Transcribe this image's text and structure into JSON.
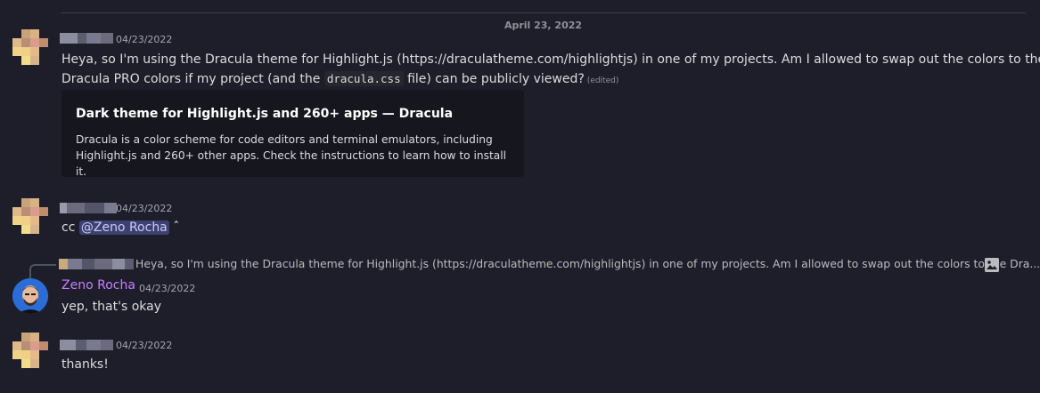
{
  "divider": {
    "date": "April 23, 2022"
  },
  "messages": [
    {
      "timestamp": "04/23/2022",
      "text_prefix": "Heya, so I'm using the Dracula theme for Highlight.js (",
      "link": "https://draculatheme.com/highlightjs",
      "text_mid": ") in one of my projects. Am I allowed to swap out the colors to the",
      "text_line2_prefix": "Dracula PRO colors if my project (and the ",
      "code": "dracula.css",
      "text_line2_suffix": " file) can be publicly viewed?",
      "edited": "(edited)",
      "embed": {
        "title": "Dark theme for Highlight.js and 260+ apps — Dracula",
        "description": "Dracula is a color scheme for code editors and terminal emulators, including Highlight.js and 260+ other apps. Check the instructions to learn how to install it."
      }
    },
    {
      "timestamp": "04/23/2022",
      "prefix": "cc ",
      "mention": "@Zeno Rocha",
      "suffix": " ˆ"
    },
    {
      "reply_preview": "Heya, so I'm using the Dracula theme for Highlight.js (https://draculatheme.com/highlightjs) in one of my projects. Am I allowed to swap out the colors to the Dra...",
      "reply_media_icon": "image-icon",
      "author": "Zeno Rocha",
      "timestamp": "04/23/2022",
      "text": "yep, that's okay"
    },
    {
      "timestamp": "04/23/2022",
      "text": "thanks!"
    }
  ],
  "colors": {
    "background": "#1e1e2b",
    "mention_bg": "#3e4170",
    "zeno_name": "#c77dff"
  }
}
